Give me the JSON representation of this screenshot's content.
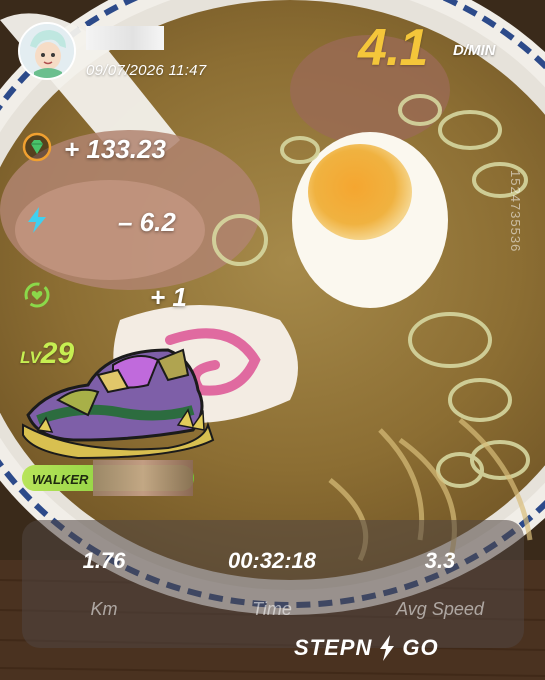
{
  "user": {
    "datetime": "09/07/2026 11:47"
  },
  "pace": {
    "value": "4.1",
    "unit": "D/MIN"
  },
  "watermark": "1524735536",
  "earnings": [
    {
      "icon": "gem-icon",
      "value": "+ 133.23"
    },
    {
      "icon": "energy-bolt-icon",
      "value": "– 6.2"
    },
    {
      "icon": "heart-recycle-icon",
      "value": "+ 1"
    }
  ],
  "sneaker": {
    "level_prefix": "LV",
    "level": "29",
    "type": "WALKER"
  },
  "stats": [
    {
      "value": "1.76",
      "label": "Km"
    },
    {
      "value": "00:32:18",
      "label": "Time"
    },
    {
      "value": "3.3",
      "label": "Avg Speed"
    }
  ],
  "brand": {
    "left": "STEPN",
    "right": "GO"
  },
  "colors": {
    "pace_yellow": "#f4c63a",
    "level_green": "#c6ef52",
    "gem_orange": "#f0a030",
    "bolt_cyan": "#3fd0f0",
    "heart_green": "#8bd84a"
  }
}
